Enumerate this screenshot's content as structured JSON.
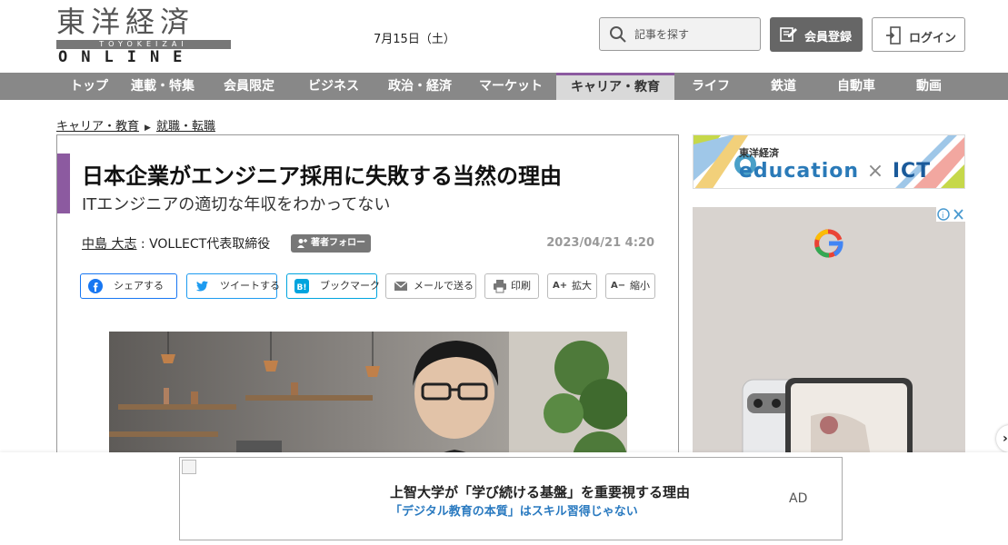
{
  "header": {
    "logo_kanji": "東洋経済",
    "logo_romaji": "TOYOKEIZAI",
    "logo_online": "ONLINE",
    "date": "7月15日（土）",
    "search_placeholder": "記事を探す",
    "register_label": "会員登録",
    "login_label": "ログイン"
  },
  "nav": {
    "items": [
      "トップ",
      "連載・特集",
      "会員限定",
      "ビジネス",
      "政治・経済",
      "マーケット",
      "キャリア・教育",
      "ライフ",
      "鉄道",
      "自動車",
      "動画"
    ],
    "active_index": 6,
    "active_color": "#8c5aa0"
  },
  "breadcrumb": [
    "キャリア・教育",
    "就職・転職"
  ],
  "article": {
    "title": "日本企業がエンジニア採用に失敗する当然の理由",
    "subtitle": "ITエンジニアの適切な年収をわかってない",
    "author": "中島 大志",
    "author_role": "VOLLECT代表取締役",
    "follow_label": "著者フォロー",
    "published": "2023/04/21 4:20",
    "share_buttons": [
      {
        "label": "シェアする",
        "icon": "facebook-icon"
      },
      {
        "label": "ツイートする",
        "icon": "twitter-icon"
      },
      {
        "label": "ブックマーク",
        "icon": "hatena-bookmark-icon"
      },
      {
        "label": "メールで送る",
        "icon": "mail-icon"
      },
      {
        "label": "印刷",
        "icon": "print-icon"
      },
      {
        "label": "拡大",
        "icon": "zoom-in-icon"
      },
      {
        "label": "縮小",
        "icon": "zoom-out-icon"
      }
    ]
  },
  "sidebar": {
    "banner_small": "東洋経済",
    "banner_main": "education",
    "banner_cross": "×",
    "banner_ict": "ICT"
  },
  "bottom_ad": {
    "headline": "上智大学が「学び続ける基盤」を重要視する理由",
    "sub": "「デジタル教育の本質」はスキル習得じゃない",
    "label": "AD"
  }
}
